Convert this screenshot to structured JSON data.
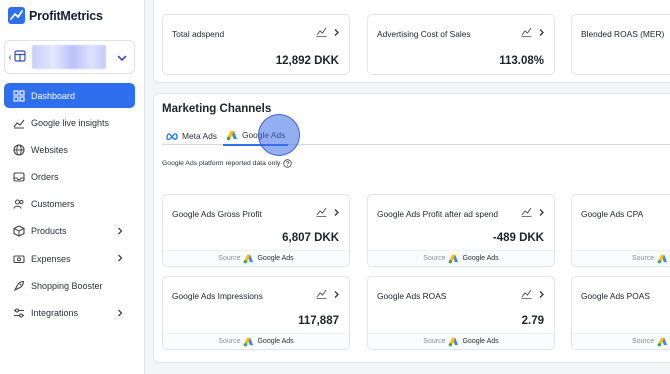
{
  "app": {
    "name": "ProfitMetrics"
  },
  "sidebar": {
    "items": [
      {
        "label": "Dashboard",
        "icon": "dashboard-icon",
        "active": true
      },
      {
        "label": "Google live insights",
        "icon": "trend-line-icon"
      },
      {
        "label": "Websites",
        "icon": "globe-icon"
      },
      {
        "label": "Orders",
        "icon": "inbox-icon"
      },
      {
        "label": "Customers",
        "icon": "users-icon"
      },
      {
        "label": "Products",
        "icon": "box-icon",
        "expandable": true
      },
      {
        "label": "Expenses",
        "icon": "money-icon",
        "expandable": true
      },
      {
        "label": "Shopping Booster",
        "icon": "rocket-icon"
      },
      {
        "label": "Integrations",
        "icon": "sliders-icon",
        "expandable": true
      }
    ]
  },
  "top_cards": [
    {
      "title": "Total adspend",
      "value": "12,892 DKK"
    },
    {
      "title": "Advertising Cost of Sales",
      "value": "113.08%"
    },
    {
      "title": "Blended ROAS (MER)",
      "value": ""
    }
  ],
  "marketing": {
    "title": "Marketing Channels",
    "tabs": [
      {
        "label": "Meta Ads",
        "icon": "meta-icon"
      },
      {
        "label": "Google Ads",
        "icon": "google-ads-icon",
        "active": true
      }
    ],
    "platform_note": "Google Ads platform reported data only",
    "source_prefix": "Source",
    "source_name": "Google Ads",
    "cards": [
      {
        "title": "Google Ads Gross Profit",
        "value": "6,807 DKK"
      },
      {
        "title": "Google Ads Profit after ad spend",
        "value": "-489 DKK"
      },
      {
        "title": "Google Ads CPA",
        "value": ""
      },
      {
        "title": "Google Ads Impressions",
        "value": "117,887"
      },
      {
        "title": "Google Ads ROAS",
        "value": "2.79"
      },
      {
        "title": "Google Ads POAS",
        "value": ""
      }
    ]
  },
  "colors": {
    "accent": "#2f6fed",
    "google_blue": "#4285f4",
    "google_yellow": "#fbbc04",
    "google_green": "#34a853"
  }
}
